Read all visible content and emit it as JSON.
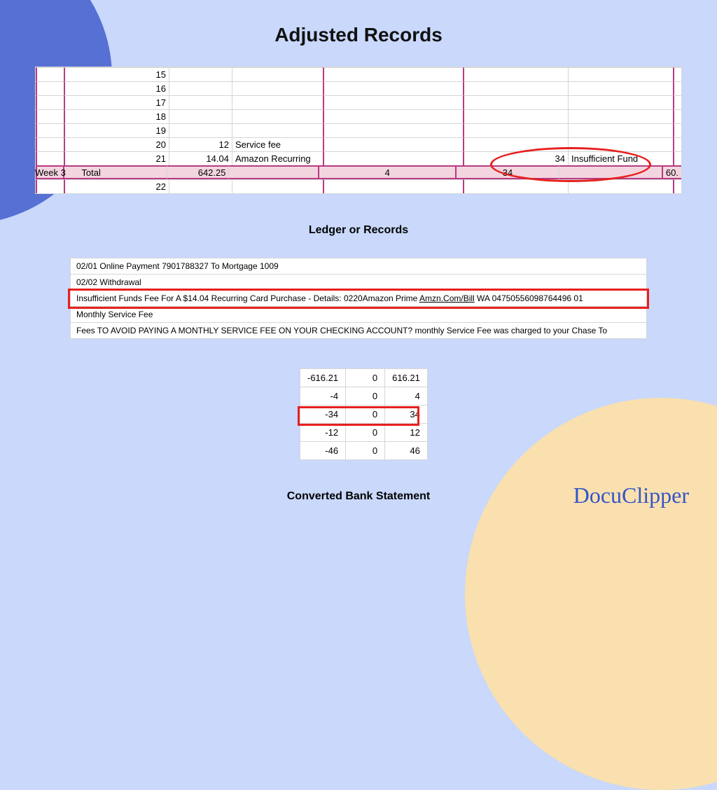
{
  "title": "Adjusted Records",
  "ledger_caption": "Ledger or Records",
  "converted_caption": "Converted Bank Statement",
  "brand": "DocuClipper",
  "week_label": "Week 3",
  "ledger": {
    "rows": [
      {
        "num": "15",
        "amt": "",
        "desc": "",
        "mid": "",
        "v2": "",
        "v3": ""
      },
      {
        "num": "16",
        "amt": "",
        "desc": "",
        "mid": "",
        "v2": "",
        "v3": ""
      },
      {
        "num": "17",
        "amt": "",
        "desc": "",
        "mid": "",
        "v2": "",
        "v3": ""
      },
      {
        "num": "18",
        "amt": "",
        "desc": "",
        "mid": "",
        "v2": "",
        "v3": ""
      },
      {
        "num": "19",
        "amt": "",
        "desc": "",
        "mid": "",
        "v2": "",
        "v3": ""
      },
      {
        "num": "20",
        "amt": "12",
        "desc": "Service fee",
        "mid": "",
        "v2": "",
        "v3": ""
      },
      {
        "num": "21",
        "amt": "14.04",
        "desc": "Amazon Recurring",
        "mid": "",
        "v2": "34",
        "v3": "Insufficient Fund"
      }
    ],
    "total": {
      "label": "Total",
      "amt": "642.25",
      "mid": "4",
      "v2": "34",
      "extra": "60."
    },
    "post": {
      "num": "22"
    }
  },
  "statement": [
    "02/01 Online Payment 7901788327 To Mortgage 1009",
    "02/02 Withdrawal",
    "Insufficient Funds Fee For A $14.04 Recurring Card Purchase - Details: 0220Amazon Prime Amzn.Com/Bill WA 04750556098764496 01",
    "Monthly Service Fee",
    "Fees TO AVOID PAYING A MONTHLY SERVICE FEE ON YOUR CHECKING ACCOUNT? monthly Service Fee was charged to your Chase To"
  ],
  "statement_highlight_index": 2,
  "nums": [
    [
      "-616.21",
      "0",
      "616.21"
    ],
    [
      "-4",
      "0",
      "4"
    ],
    [
      "-34",
      "0",
      "34"
    ],
    [
      "-12",
      "0",
      "12"
    ],
    [
      "-46",
      "0",
      "46"
    ]
  ]
}
